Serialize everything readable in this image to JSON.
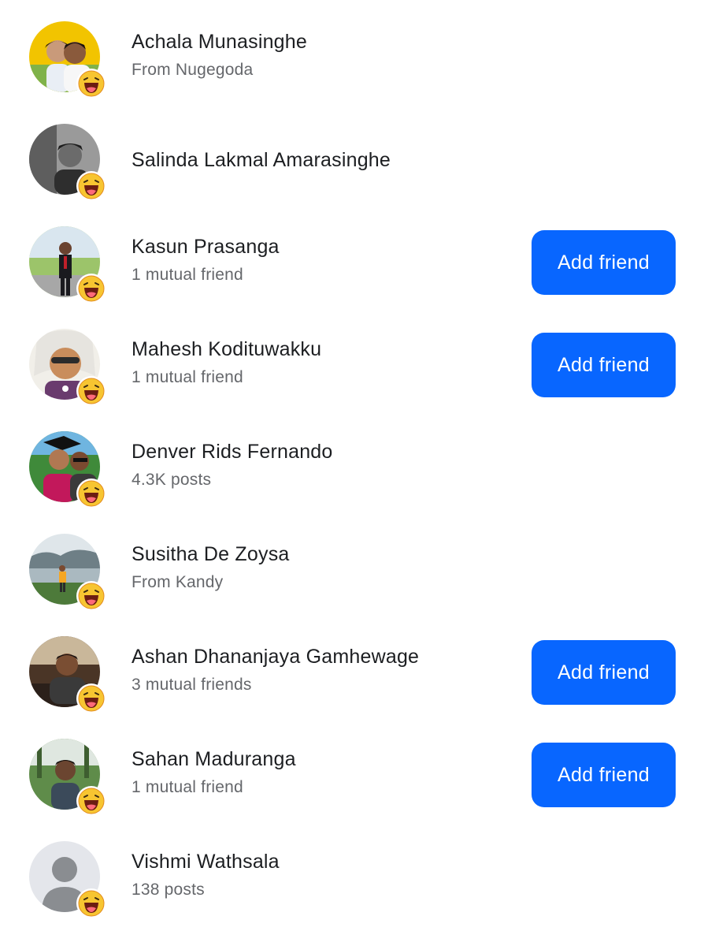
{
  "people": [
    {
      "name": "Achala Munasinghe",
      "subtitle": "From Nugegoda",
      "button": null
    },
    {
      "name": "Salinda Lakmal Amarasinghe",
      "subtitle": "",
      "button": null
    },
    {
      "name": "Kasun Prasanga",
      "subtitle": "1 mutual friend",
      "button": "Add friend"
    },
    {
      "name": "Mahesh Kodituwakku",
      "subtitle": "1 mutual friend",
      "button": "Add friend"
    },
    {
      "name": "Denver Rids Fernando",
      "subtitle": "4.3K posts",
      "button": null
    },
    {
      "name": "Susitha De Zoysa",
      "subtitle": "From Kandy",
      "button": null
    },
    {
      "name": "Ashan Dhananjaya Gamhewage",
      "subtitle": "3 mutual friends",
      "button": "Add friend"
    },
    {
      "name": "Sahan Maduranga",
      "subtitle": "1 mutual friend",
      "button": "Add friend"
    },
    {
      "name": "Vishmi Wathsala",
      "subtitle": "138 posts",
      "button": null
    }
  ],
  "reaction_icon": "haha-emoji-icon",
  "colors": {
    "button": "#0866ff",
    "name": "#1c1e21",
    "subtitle": "#65676b"
  }
}
